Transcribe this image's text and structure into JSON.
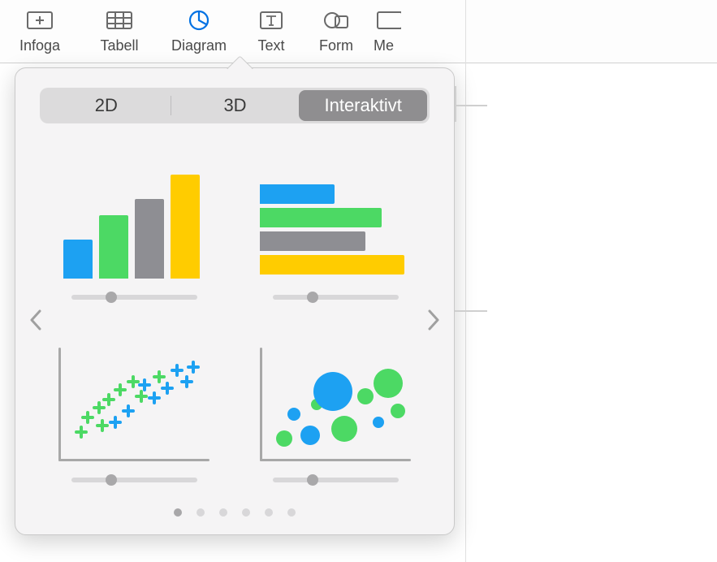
{
  "toolbar": {
    "items": [
      {
        "label": "Infoga",
        "icon": "insert"
      },
      {
        "label": "Tabell",
        "icon": "table"
      },
      {
        "label": "Diagram",
        "icon": "chart",
        "active": true
      },
      {
        "label": "Text",
        "icon": "text"
      },
      {
        "label": "Form",
        "icon": "shape"
      },
      {
        "label": "Me",
        "icon": "media"
      }
    ]
  },
  "popover": {
    "tabs": {
      "two_d": "2D",
      "three_d": "3D",
      "interactive": "Interaktivt",
      "selected": "interactive"
    },
    "page_count": 6,
    "current_page": 1,
    "options": [
      {
        "name": "interactive-column-chart"
      },
      {
        "name": "interactive-bar-chart"
      },
      {
        "name": "interactive-scatter-chart"
      },
      {
        "name": "interactive-bubble-chart"
      }
    ]
  },
  "colors": {
    "blue": "#1da1f2",
    "green": "#4cd964",
    "gray": "#8e8e93",
    "yellow": "#ffcc00",
    "dark": "#6f6f74"
  }
}
